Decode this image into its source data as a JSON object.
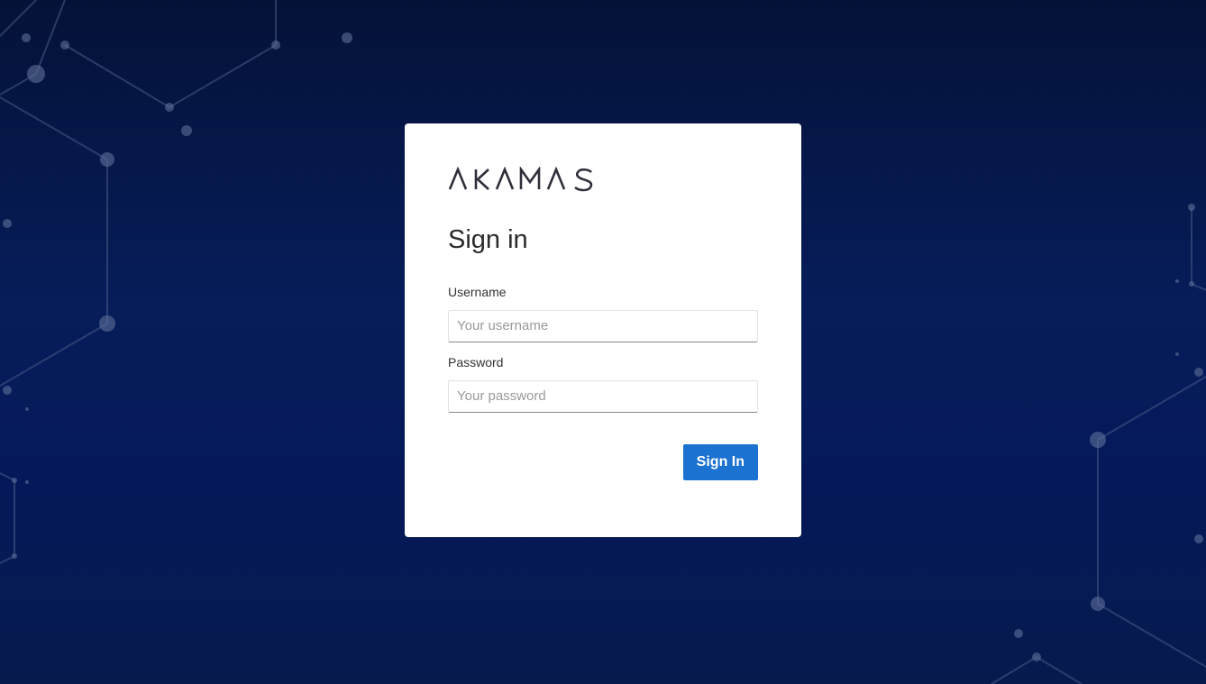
{
  "brand": {
    "logo_text": "AKAMAS"
  },
  "login": {
    "title": "Sign in",
    "username_label": "Username",
    "username_placeholder": "Your username",
    "username_value": "",
    "password_label": "Password",
    "password_placeholder": "Your password",
    "password_value": "",
    "submit_label": "Sign In"
  },
  "colors": {
    "background": "#061d5a",
    "card": "#ffffff",
    "primary_button": "#1b72d1",
    "network_lines": "#5e6f99"
  }
}
